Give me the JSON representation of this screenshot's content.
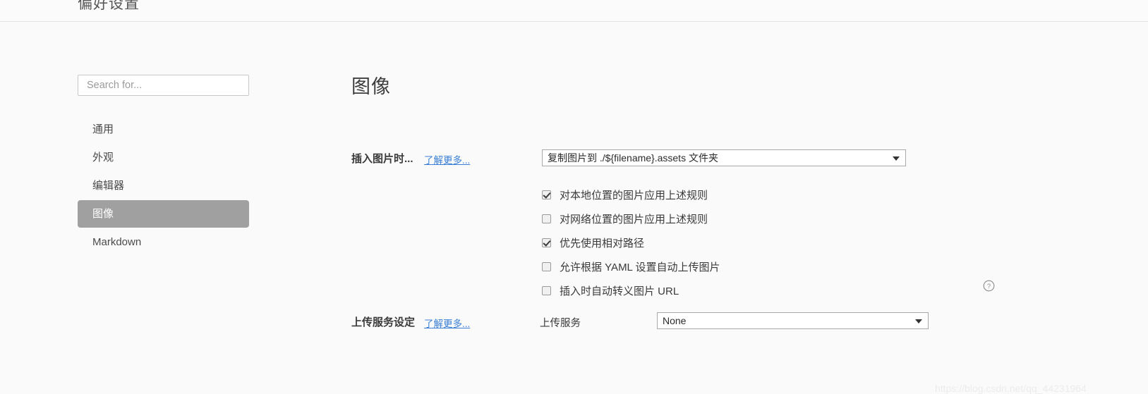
{
  "window": {
    "title": "偏好设置"
  },
  "sidebar": {
    "search": {
      "placeholder": "Search for...",
      "value": ""
    },
    "items": [
      {
        "label": "通用",
        "selected": false
      },
      {
        "label": "外观",
        "selected": false
      },
      {
        "label": "编辑器",
        "selected": false
      },
      {
        "label": "图像",
        "selected": true
      },
      {
        "label": "Markdown",
        "selected": false
      }
    ]
  },
  "main": {
    "page_title": "图像",
    "insert_image_section": {
      "label": "插入图片时...",
      "learn_more_label": "了解更多...",
      "dropdown_value": "复制图片到 ./${filename}.assets 文件夹",
      "options": [
        "复制图片到 ./${filename}.assets 文件夹"
      ],
      "checkboxes": [
        {
          "label": "对本地位置的图片应用上述规则",
          "checked": true
        },
        {
          "label": "对网络位置的图片应用上述规则",
          "checked": false
        },
        {
          "label": "优先使用相对路径",
          "checked": true
        },
        {
          "label": "允许根据 YAML 设置自动上传图片",
          "checked": false
        },
        {
          "label": "插入时自动转义图片 URL",
          "checked": false
        }
      ],
      "help_icon": "help-circle-icon"
    },
    "upload_service_section": {
      "label": "上传服务设定",
      "learn_more_label": "了解更多...",
      "field_label": "上传服务",
      "dropdown_value": "None",
      "options": [
        "None"
      ]
    }
  },
  "watermark": {
    "text": "https://blog.csdn.net/qq_44231964"
  },
  "colors": {
    "selected_item_bg": "#a0a0a0",
    "link": "#3a7fd5",
    "page_bg": "#fafafa"
  }
}
